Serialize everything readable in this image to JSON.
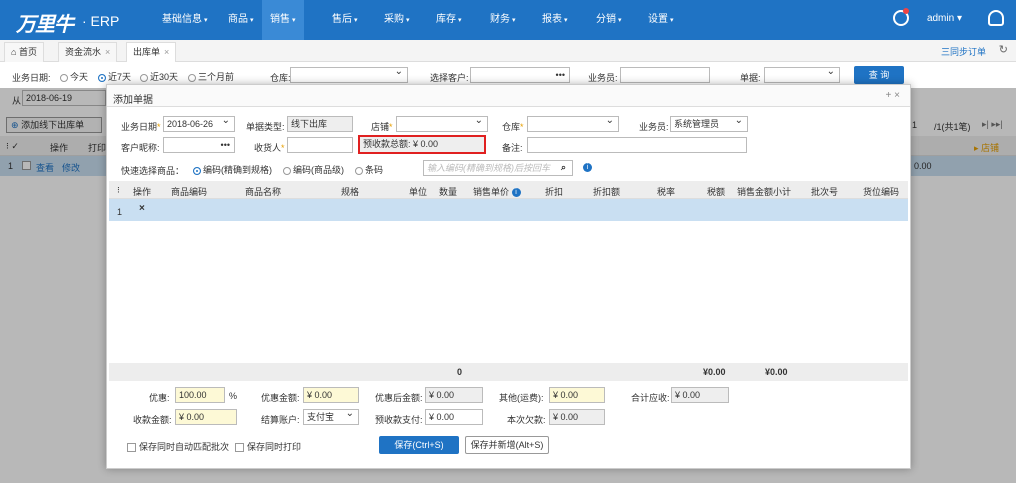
{
  "header": {
    "logo": "万里牛",
    "app": "· ERP",
    "nav": [
      "基础信息",
      "商品",
      "销售",
      "售后",
      "采购",
      "库存",
      "财务",
      "报表",
      "分销",
      "设置"
    ],
    "active_nav": "销售",
    "user": "admin"
  },
  "tabs": [
    {
      "label": "首页"
    },
    {
      "label": "资金流水"
    },
    {
      "label": "出库单"
    }
  ],
  "tab_actions": {
    "sync": "三同步订单"
  },
  "filters": {
    "date_label": "业务日期:",
    "opt_today": "今天",
    "opt_7": "近7天",
    "opt_30": "近30天",
    "opt_3m": "三个月前",
    "warehouse_label": "仓库:",
    "customer_label": "选择客户:",
    "salesman_label": "业务员:",
    "doc_label": "单据:",
    "search_button": "查 询",
    "from_label": "从",
    "from_date": "2018-06-19"
  },
  "background": {
    "add_button": "添加线下出库单",
    "col_op": "操作",
    "col_print": "打印",
    "row_num": "1",
    "row_view": "查看",
    "row_edit": "修改",
    "pager": "/1(共1笔)",
    "col_store": "店铺",
    "amount": "0.00",
    "page_num": "1"
  },
  "modal": {
    "title": "添加单据",
    "biz_date_label": "业务日期",
    "biz_date": "2018-06-26",
    "doc_type_label": "单据类型:",
    "doc_type": "线下出库",
    "store_label": "店铺",
    "warehouse_label": "仓库",
    "salesman_label": "业务员:",
    "salesman": "系统管理员",
    "customer_label": "客户昵称:",
    "receiver_label": "收货人",
    "prepay_total_label": "预收款总额:",
    "prepay_total": "¥ 0.00",
    "remark_label": "备注:",
    "quick_label": "快速选择商品：",
    "opt_code_exact": "编码(精确到规格)",
    "opt_code_goods": "编码(商品级)",
    "opt_barcode": "条码",
    "scan_placeholder": "输入编码(精确到规格)后按回车",
    "columns": [
      "操作",
      "商品编码",
      "商品名称",
      "规格",
      "单位",
      "数量",
      "销售单价",
      "折扣",
      "折扣额",
      "税率",
      "税额",
      "销售金额小计",
      "批次号",
      "货位编码"
    ],
    "row_index": "1",
    "row_delete": "×",
    "foot_qty": "0",
    "foot_tax": "¥0.00",
    "foot_subtotal": "¥0.00",
    "discount_label": "优惠:",
    "discount_value": "100.00",
    "discount_unit": "%",
    "discount_amt_label": "优惠金额:",
    "discount_amt": "¥ 0.00",
    "after_discount_label": "优惠后金额:",
    "after_discount": "¥ 0.00",
    "other_label": "其他(运费):",
    "other": "¥ 0.00",
    "total_label": "合计应收:",
    "total": "¥ 0.00",
    "received_label": "收款金额:",
    "received": "¥ 0.00",
    "account_label": "结算账户:",
    "account": "支付宝",
    "prepay_pay_label": "预收款支付:",
    "prepay_pay": "¥ 0.00",
    "owed_label": "本次欠款:",
    "owed": "¥ 0.00",
    "auto_batch": "保存同时自动匹配批次",
    "save_print": "保存同时打印",
    "save_button": "保存(Ctrl+S)",
    "save_new_button": "保存并新增(Alt+S)"
  }
}
